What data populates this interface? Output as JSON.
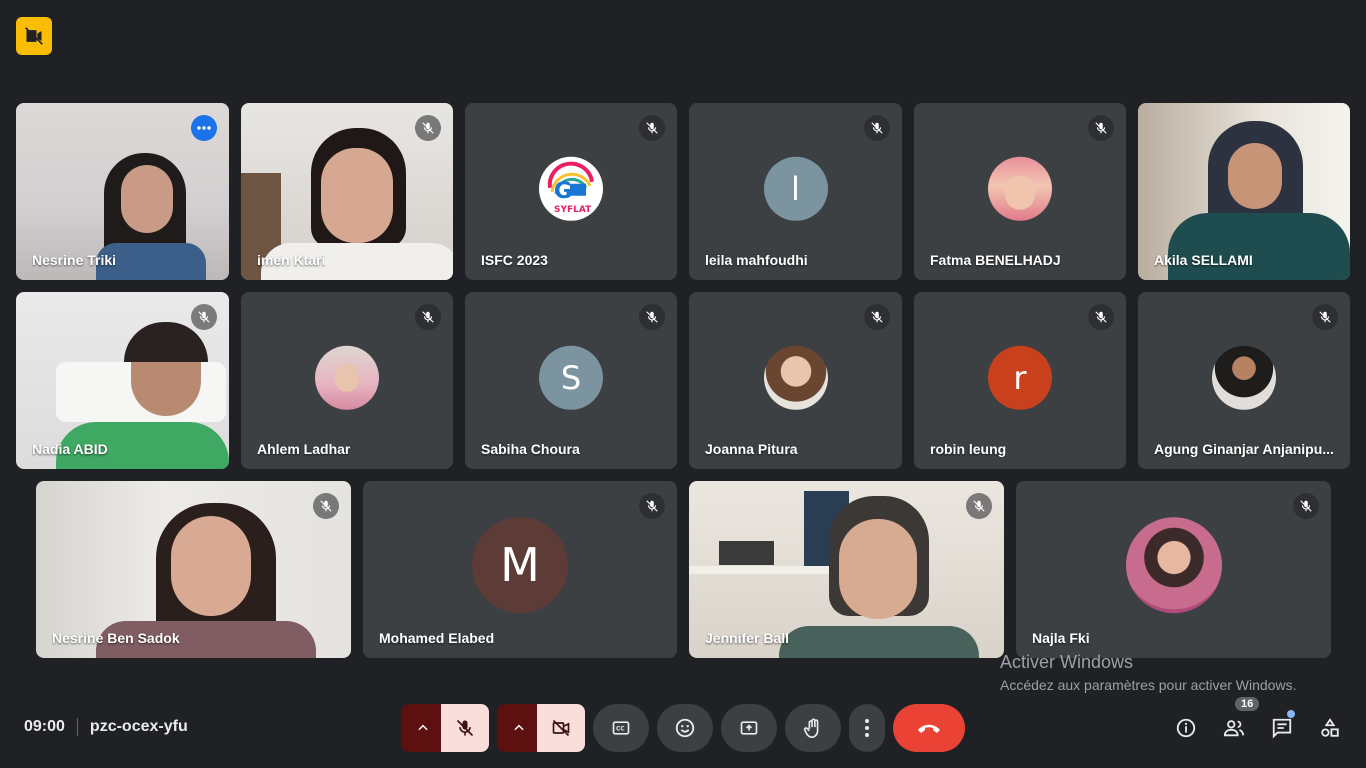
{
  "meeting": {
    "time": "09:00",
    "code": "pzc-ocex-yfu",
    "participants_count": "16"
  },
  "watermark": {
    "title": "Activer Windows",
    "subtitle": "Accédez aux paramètres pour activer Windows."
  },
  "tiles": [
    {
      "name": "Nesrine Triki"
    },
    {
      "name": "imen Ktari"
    },
    {
      "name": "ISFC 2023",
      "logo_text": "SYFLAT"
    },
    {
      "name": "leila mahfoudhi",
      "initial": "l"
    },
    {
      "name": "Fatma BENELHADJ"
    },
    {
      "name": "Akila SELLAMI"
    },
    {
      "name": "Nadia ABID"
    },
    {
      "name": "Ahlem Ladhar"
    },
    {
      "name": "Sabiha Choura",
      "initial": "S"
    },
    {
      "name": "Joanna Pitura"
    },
    {
      "name": "robin leung",
      "initial": "r"
    },
    {
      "name": "Agung Ginanjar Anjanipu..."
    },
    {
      "name": "Nesrine Ben Sadok"
    },
    {
      "name": "Mohamed Elabed",
      "initial": "M"
    },
    {
      "name": "Jennifer Ball"
    },
    {
      "name": "Najla Fki"
    }
  ],
  "colors": {
    "background": "#202124",
    "tile": "#3c4043",
    "active_border": "#8ab4f8",
    "end_call": "#ea4335",
    "avatar_slate": "#7b949f",
    "avatar_orange": "#c8401c",
    "avatar_brown": "#5d3b36"
  }
}
